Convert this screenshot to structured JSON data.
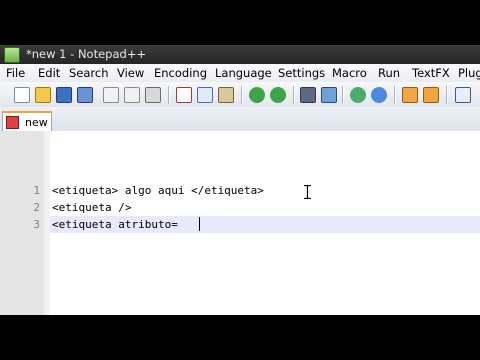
{
  "window": {
    "title": "*new 1 - Notepad++"
  },
  "menu": [
    "File",
    "Edit",
    "Search",
    "View",
    "Encoding",
    "Language",
    "Settings",
    "Macro",
    "Run",
    "TextFX",
    "Plug"
  ],
  "toolbar": {
    "buttons": [
      "new-file-icon",
      "open-file-icon",
      "save-icon",
      "save-all-icon",
      "close-icon",
      "close-all-icon",
      "print-icon",
      "cut-icon",
      "copy-icon",
      "paste-icon",
      "undo-icon",
      "redo-icon",
      "find-icon",
      "replace-icon",
      "zoom-in-icon",
      "zoom-out-icon",
      "sync-scroll-v-icon",
      "sync-scroll-h-icon",
      "word-wrap-icon"
    ]
  },
  "tabs": [
    {
      "label": "new 1"
    }
  ],
  "editor": {
    "lines": [
      {
        "number": "1",
        "text": "<etiqueta> algo aqui </etiqueta>"
      },
      {
        "number": "2",
        "text": "<etiqueta />"
      },
      {
        "number": "3",
        "text": "<etiqueta atributo="
      }
    ],
    "current_line": 3
  },
  "colors": {
    "accent_tab": "#f3a33a",
    "current_line": "#e8e8ff"
  }
}
